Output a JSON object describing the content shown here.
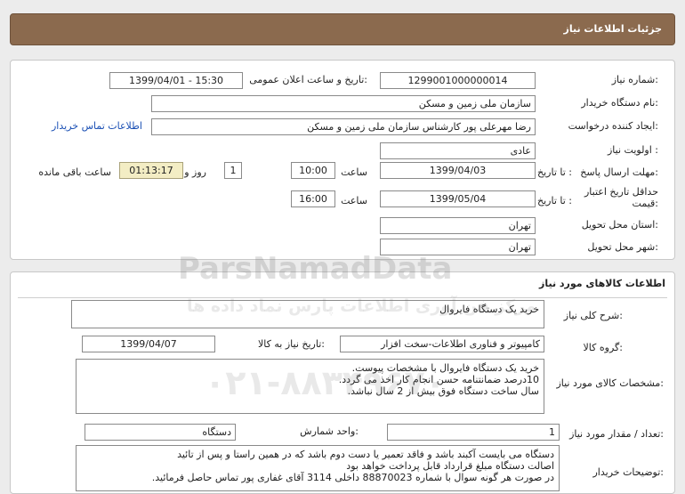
{
  "header": {
    "title": "جزئیات اطلاعات نیاز"
  },
  "need_info": {
    "need_number_label": "شماره نیاز:",
    "need_number": "1299001000000014",
    "announce_label": "تاریخ و ساعت اعلان عمومی:",
    "announce_value": "1399/04/01 - 15:30",
    "buyer_org_label": "نام دستگاه خریدار:",
    "buyer_org": "سازمان ملی زمین و مسکن",
    "requester_label": "ایجاد کننده درخواست:",
    "requester": "رضا مهرعلی پور کارشناس سازمان ملی زمین و مسکن",
    "contact_link": "اطلاعات تماس خریدار",
    "priority_label": "اولویت نیاز :",
    "priority": "عادی",
    "deadline_label": "مهلت ارسال پاسخ:",
    "to_date_label": "تا تاریخ :",
    "deadline_date": "1399/04/03",
    "time_label": "ساعت",
    "deadline_time": "10:00",
    "days_value": "1",
    "days_label": "روز و",
    "remaining_time": "01:13:17",
    "remaining_label": "ساعت باقی مانده",
    "validity_label_1": "حداقل تاریخ اعتبار",
    "validity_label_2": "قیمت:",
    "validity_to_date_label": "تا تاریخ :",
    "validity_date": "1399/05/04",
    "validity_time_label": "ساعت",
    "validity_time": "16:00",
    "province_label": "استان محل تحویل:",
    "province": "تهران",
    "city_label": "شهر محل تحویل:",
    "city": "تهران"
  },
  "goods_info": {
    "section_title": "اطلاعات کالاهای مورد نیاز",
    "summary_label": "شرح کلی نیاز:",
    "summary": "خرید یک دستگاه فایروال",
    "group_label": "گروه کالا:",
    "group": "کامپیوتر و فناوری اطلاعات-سخت افزار",
    "need_date_label": "تاریخ نیاز به کالا:",
    "need_date": "1399/04/07",
    "specs_label": "مشخصات کالای مورد نیاز:",
    "specs_lines": [
      "خرید یک دستگاه فایروال با مشخصات پیوست.",
      "10درصد ضمانتنامه حسن انجام کار اخذ می گردد.",
      "سال ساخت دستگاه فوق بیش از 2 سال نباشد."
    ],
    "qty_label": "تعداد / مقدار مورد نیاز:",
    "qty": "1",
    "unit_label": "واحد شمارش:",
    "unit": "دستگاه",
    "buyer_notes_label": "توضیحات خریدار:",
    "buyer_notes_lines": [
      "دستگاه می بایست آکبند باشد و فاقد تعمیر یا دست دوم باشد که در همین راستا و پس از تائید",
      "اصالت دستگاه مبلغ قرارداد قابل پرداخت خواهد بود",
      "در صورت هر گونه سوال با شماره 88870023 داخلی 3114 آقای غفاری پور تماس حاصل فرمائید."
    ]
  },
  "watermark": {
    "text_en": "ParsNamadData",
    "text_fa": "مرکز فن آوری اطلاعات پارس نماد داده ها",
    "phone": "۰۲۱-۸۸۳۴۹۶۷۰"
  }
}
